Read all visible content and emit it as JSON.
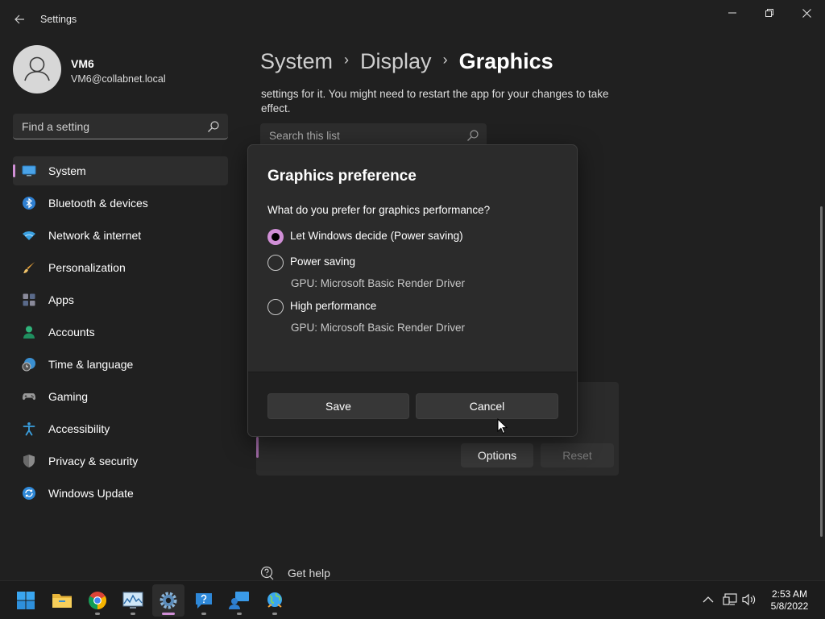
{
  "window": {
    "title": "Settings",
    "controls": {
      "minimize": "minimize-icon",
      "maximize": "restore-icon",
      "close": "close-icon"
    }
  },
  "profile": {
    "name": "VM6",
    "email": "VM6@collabnet.local"
  },
  "sidebar": {
    "search_placeholder": "Find a setting",
    "items": [
      {
        "label": "System",
        "icon": "display-icon",
        "selected": true
      },
      {
        "label": "Bluetooth & devices",
        "icon": "bluetooth-icon"
      },
      {
        "label": "Network & internet",
        "icon": "wifi-icon"
      },
      {
        "label": "Personalization",
        "icon": "brush-icon"
      },
      {
        "label": "Apps",
        "icon": "apps-icon"
      },
      {
        "label": "Accounts",
        "icon": "person-icon"
      },
      {
        "label": "Time & language",
        "icon": "clock-globe-icon"
      },
      {
        "label": "Gaming",
        "icon": "gamepad-icon"
      },
      {
        "label": "Accessibility",
        "icon": "accessibility-icon"
      },
      {
        "label": "Privacy & security",
        "icon": "shield-icon"
      },
      {
        "label": "Windows Update",
        "icon": "update-icon"
      }
    ]
  },
  "main": {
    "breadcrumb": [
      "System",
      "Display",
      "Graphics"
    ],
    "description": "settings for it. You might need to restart the app for your changes to take effect.",
    "list_search_placeholder": "Search this list",
    "options_label": "Options",
    "reset_label": "Reset",
    "get_help": "Get help"
  },
  "dialog": {
    "title": "Graphics preference",
    "question": "What do you prefer for graphics performance?",
    "options": [
      {
        "label": "Let Windows decide (Power saving)",
        "sub": "",
        "checked": true
      },
      {
        "label": "Power saving",
        "sub": "GPU: Microsoft Basic Render Driver",
        "checked": false
      },
      {
        "label": "High performance",
        "sub": "GPU: Microsoft Basic Render Driver",
        "checked": false
      }
    ],
    "save_label": "Save",
    "cancel_label": "Cancel"
  },
  "taskbar": {
    "apps": [
      "windows-start-icon",
      "file-explorer-icon",
      "chrome-icon",
      "performance-monitor-icon",
      "settings-icon",
      "help-icon",
      "remote-desktop-icon",
      "globe-network-icon"
    ],
    "active_app": "settings-icon",
    "time": "2:53 AM",
    "date": "5/8/2022"
  },
  "colors": {
    "accent": "#d08fd6",
    "background": "#202020",
    "surface": "#2b2b2b",
    "taskbar": "#1c1c1c"
  }
}
